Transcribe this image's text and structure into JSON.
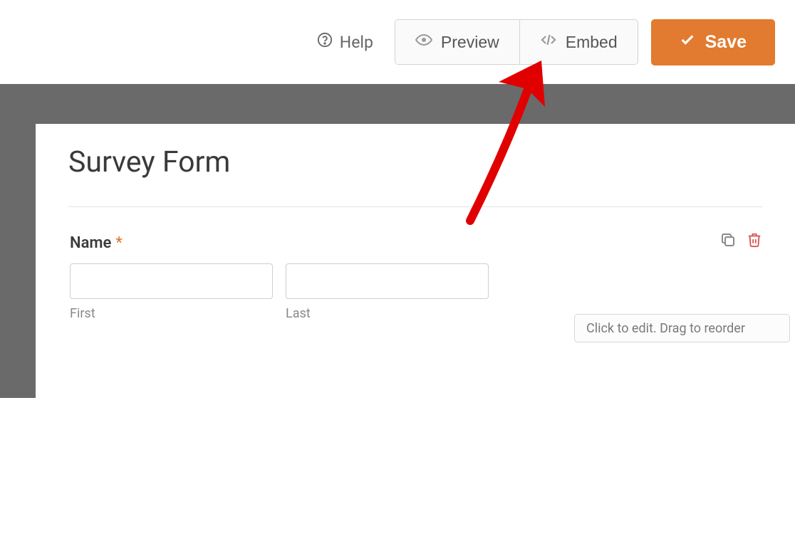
{
  "toolbar": {
    "help_label": "Help",
    "preview_label": "Preview",
    "embed_label": "Embed",
    "save_label": "Save"
  },
  "form": {
    "title": "Survey Form",
    "field_name": {
      "label": "Name",
      "required": "*",
      "first_sublabel": "First",
      "last_sublabel": "Last",
      "first_value": "",
      "last_value": ""
    },
    "hint_text": "Click to edit. Drag to reorder"
  },
  "colors": {
    "accent": "#e27a2f",
    "annotation": "#e10000"
  }
}
